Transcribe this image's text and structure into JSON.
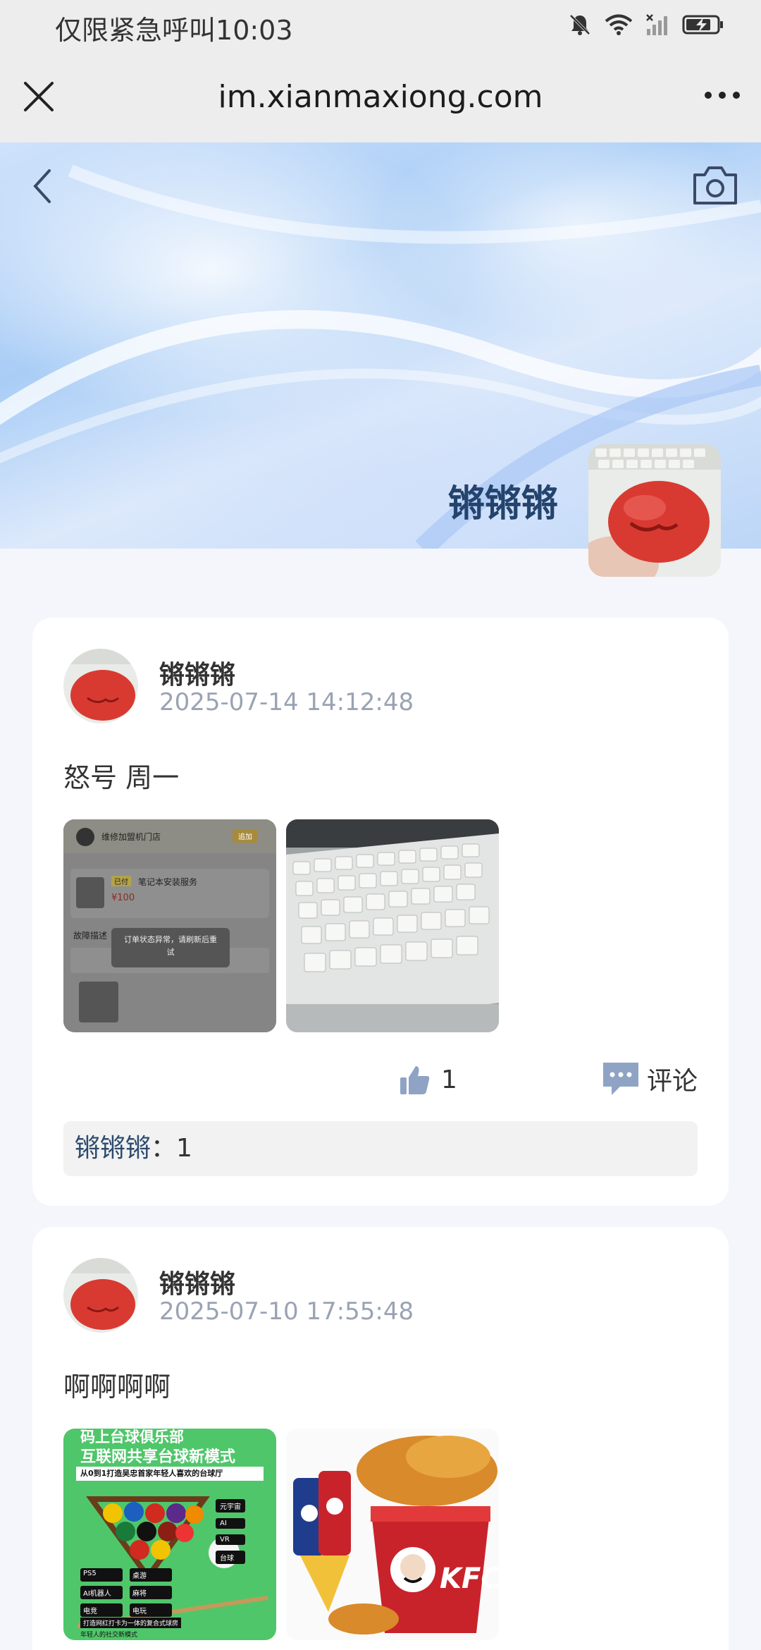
{
  "status_bar": {
    "carrier_text": "仅限紧急呼叫",
    "time": "10:03",
    "icons": [
      "bell-muted-icon",
      "wifi-icon",
      "signal-icon",
      "battery-charging-icon"
    ]
  },
  "browser": {
    "url": "im.xianmaxiong.com",
    "close_icon": "close-icon",
    "more_icon": "more-icon"
  },
  "profile": {
    "name": "锵锵锵",
    "back_icon": "chevron-left-icon",
    "camera_icon": "camera-icon"
  },
  "posts": [
    {
      "author": "锵锵锵",
      "time": "2025-07-14 14:12:48",
      "content": "怒号 周一",
      "images": [
        {
          "title": "维修加盟机门店",
          "button": "追加",
          "service_tag": "已付",
          "service": "笔记本安装服务",
          "price": "¥100",
          "label": "故障描述",
          "toast": "订单状态异常，请刷新后重试"
        },
        {
          "alt": "keyboard"
        }
      ],
      "likes": "1",
      "comment_label": "评论",
      "liked_by": "锵锵锵",
      "liked_sep": "：",
      "liked_value": "1"
    },
    {
      "author": "锵锵锵",
      "time": "2025-07-10 17:55:48",
      "content": "啊啊啊啊",
      "images": [
        {
          "title1": "码上台球俱乐部",
          "title2": "互联网共享台球新模式",
          "subtitle": "从0到1打造吴忠首家年轻人喜欢的台球厅",
          "tags_left": [
            "PS5",
            "桌游",
            "AI机器人",
            "麻将",
            "电竞",
            "电玩"
          ],
          "tags_right": [
            "元宇宙",
            "AI",
            "VR",
            "台球"
          ],
          "footer1": "打造网红打卡为一体的复合式球房",
          "footer2": "年轻人的社交新模式"
        },
        {
          "brand": "KFC"
        }
      ]
    }
  ]
}
